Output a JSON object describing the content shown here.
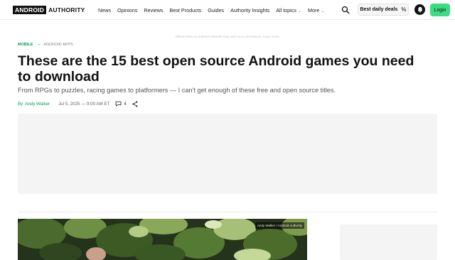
{
  "header": {
    "logo_box": "ANDROID",
    "logo_text": "AUTHORITY",
    "nav": [
      {
        "label": "News"
      },
      {
        "label": "Opinions"
      },
      {
        "label": "Reviews"
      },
      {
        "label": "Best Products"
      },
      {
        "label": "Guides"
      },
      {
        "label": "Authority Insights"
      },
      {
        "label": "All topics"
      },
      {
        "label": "More"
      }
    ],
    "deals_label": "Best daily deals",
    "login_label": "Login",
    "accent_color": "#3ddc84"
  },
  "affiliate_notice": "Affiliate links on Android Authority may earn us a commission. Learn more.",
  "breadcrumb": {
    "primary": "MOBILE",
    "secondary": "ANDROID APPS"
  },
  "article": {
    "headline": "These are the 15 best open source Android games you need to download",
    "subtitle": "From RPGs to puzzles, racing games to platformers — I can't get enough of these free and open source titles.",
    "by_label": "By",
    "author": "Andy Walker",
    "date": "Jul 5, 2025 — 9:00 AM ET",
    "comment_count": "4"
  },
  "hero": {
    "credit": "Andy Walker / Android Authority"
  }
}
